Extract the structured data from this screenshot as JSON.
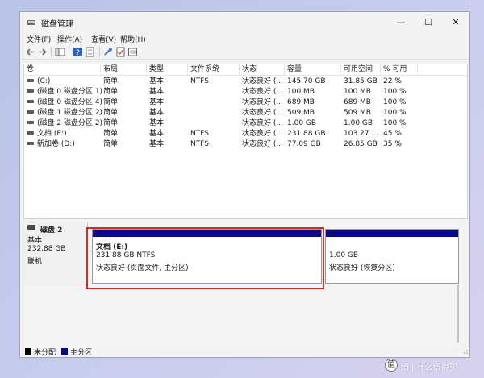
{
  "window": {
    "title": "磁盘管理",
    "controls": {
      "minimize": "—",
      "maximize": "☐",
      "close": "✕"
    }
  },
  "menu": [
    "文件(F)",
    "操作(A)",
    "查看(V)",
    "帮助(H)"
  ],
  "toolbar": [
    "back-icon",
    "forward-icon",
    "console-tree-icon",
    "help-icon",
    "properties-icon",
    "connect-icon",
    "check-icon",
    "more-icon"
  ],
  "columns": [
    "卷",
    "布局",
    "类型",
    "文件系统",
    "状态",
    "容量",
    "可用空间",
    "% 可用"
  ],
  "volumes": [
    {
      "name": "(C:)",
      "layout": "简单",
      "type": "基本",
      "fs": "NTFS",
      "status": "状态良好 (...",
      "capacity": "145.70 GB",
      "free": "31.85 GB",
      "pct": "22 %"
    },
    {
      "name": "(磁盘 0 磁盘分区 1)",
      "layout": "简单",
      "type": "基本",
      "fs": "",
      "status": "状态良好 (...",
      "capacity": "100 MB",
      "free": "100 MB",
      "pct": "100 %"
    },
    {
      "name": "(磁盘 0 磁盘分区 4)",
      "layout": "简单",
      "type": "基本",
      "fs": "",
      "status": "状态良好 (...",
      "capacity": "689 MB",
      "free": "689 MB",
      "pct": "100 %"
    },
    {
      "name": "(磁盘 1 磁盘分区 2)",
      "layout": "简单",
      "type": "基本",
      "fs": "",
      "status": "状态良好 (...",
      "capacity": "509 MB",
      "free": "509 MB",
      "pct": "100 %"
    },
    {
      "name": "(磁盘 2 磁盘分区 2)",
      "layout": "简单",
      "type": "基本",
      "fs": "",
      "status": "状态良好 (...",
      "capacity": "1.00 GB",
      "free": "1.00 GB",
      "pct": "100 %"
    },
    {
      "name": "文档 (E:)",
      "layout": "简单",
      "type": "基本",
      "fs": "NTFS",
      "status": "状态良好 (...",
      "capacity": "231.88 GB",
      "free": "103.27 ...",
      "pct": "45 %"
    },
    {
      "name": "新加卷 (D:)",
      "layout": "简单",
      "type": "基本",
      "fs": "NTFS",
      "status": "状态良好 (...",
      "capacity": "77.09 GB",
      "free": "26.85 GB",
      "pct": "35 %"
    }
  ],
  "disk": {
    "name": "磁盘 2",
    "type": "基本",
    "size": "232.88 GB",
    "state": "联机"
  },
  "partitions": [
    {
      "title": "文档  (E:)",
      "size": "231.88 GB NTFS",
      "status": "状态良好 (页面文件, 主分区)"
    },
    {
      "title": "",
      "size": "1.00 GB",
      "status": "状态良好 (恢复分区)"
    }
  ],
  "legend": {
    "unallocated": "未分配",
    "primary": "主分区",
    "colors": {
      "unallocated": "#000000",
      "primary": "#0a0a84"
    }
  },
  "watermark": {
    "text": "值 | 什么值得买",
    "icon": "值"
  },
  "colors": {
    "partition_bar": "#0a0a84",
    "highlight": "#d42a2a"
  }
}
